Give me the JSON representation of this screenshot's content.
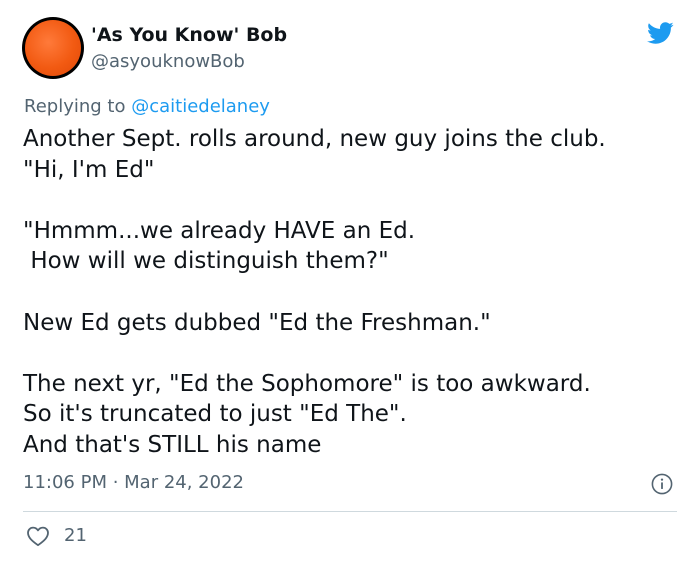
{
  "author": {
    "display_name": "'As You Know' Bob",
    "handle": "@asyouknowBob"
  },
  "reply": {
    "prefix": "Replying to ",
    "mention": "@caitiedelaney"
  },
  "tweet": {
    "text": "Another Sept. rolls around, new guy joins the club.\n\"Hi, I'm Ed\"\n\n\"Hmmm...we already HAVE an Ed.\n How will we distinguish them?\"\n\nNew Ed gets dubbed \"Ed the Freshman.\"\n\nThe next yr, \"Ed the Sophomore\" is too awkward.\nSo it's truncated to just \"Ed The\".\nAnd that's STILL his name",
    "timestamp": "11:06 PM · Mar 24, 2022"
  },
  "stats": {
    "likes": "21"
  },
  "icons": {
    "brand": "twitter-bird-icon",
    "info": "info-icon",
    "like": "heart-icon"
  },
  "colors": {
    "brand_blue": "#1d9bf0",
    "text_primary": "#0f1419",
    "text_secondary": "#536471",
    "divider": "#cfd9de",
    "avatar_orange": "#f25a12"
  }
}
